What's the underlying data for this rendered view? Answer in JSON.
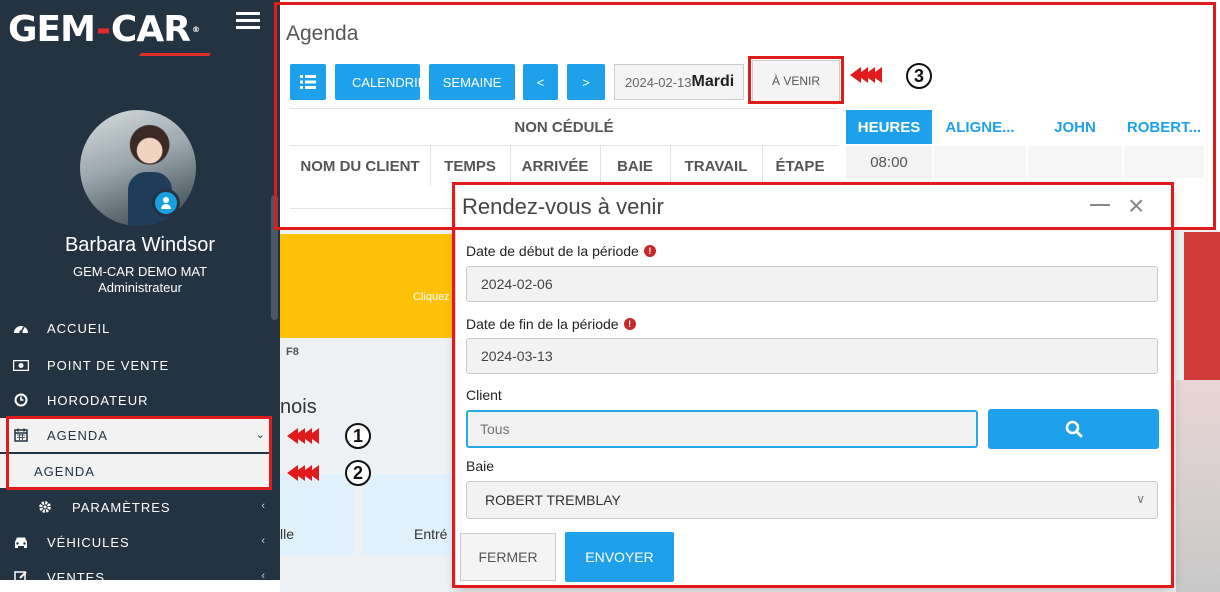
{
  "brand": {
    "logo_left": "GEM",
    "logo_dash": "-",
    "logo_right": "CAR",
    "registered": "®",
    "accent": "#e22b2b"
  },
  "user": {
    "name": "Barbara Windsor",
    "company": "GEM-CAR DEMO MAT",
    "role": "Administrateur"
  },
  "nav": {
    "accueil": "ACCUEIL",
    "point_de_vente": "POINT DE VENTE",
    "horodateur": "HORODATEUR",
    "agenda": "AGENDA",
    "agenda_sub": "AGENDA",
    "parametres": "PARAMÈTRES",
    "vehicules": "VÉHICULES",
    "ventes": "VENTES"
  },
  "agenda": {
    "title": "Agenda",
    "buttons": {
      "calendrier": "CALENDRIER",
      "semaine": "SEMAINE",
      "prev": "<",
      "next": ">"
    },
    "date": "2024-02-13",
    "day": "Mardi",
    "a_venir": "À VENIR",
    "non_cedule": "NON CÉDULÉ",
    "columns": [
      "NOM DU CLIENT",
      "TEMPS",
      "ARRIVÉE",
      "BAIE",
      "TRAVAIL",
      "ÉTAPE"
    ],
    "heures": "HEURES",
    "resources": [
      "ALIGNE...",
      "JOHN",
      "ROBERT..."
    ],
    "first_slot": "08:00"
  },
  "background": {
    "yellow_text": "Cliquez",
    "f8": "F8",
    "mois": "nois",
    "card1": "lle",
    "card2": "Entré"
  },
  "modal": {
    "title": "Rendez-vous à venir",
    "start_label": "Date de début de la période",
    "start_value": "2024-02-06",
    "end_label": "Date de fin de la période",
    "end_value": "2024-03-13",
    "client_label": "Client",
    "client_placeholder": "Tous",
    "baie_label": "Baie",
    "baie_value": "ROBERT TREMBLAY",
    "close_label": "FERMER",
    "submit_label": "ENVOYER"
  },
  "annotations": {
    "step1": "1",
    "step2": "2",
    "step3": "3"
  },
  "colors": {
    "sidebar": "#243341",
    "primary": "#1ea1ea",
    "annotation": "#e01b1b",
    "warning": "#ffc107"
  }
}
